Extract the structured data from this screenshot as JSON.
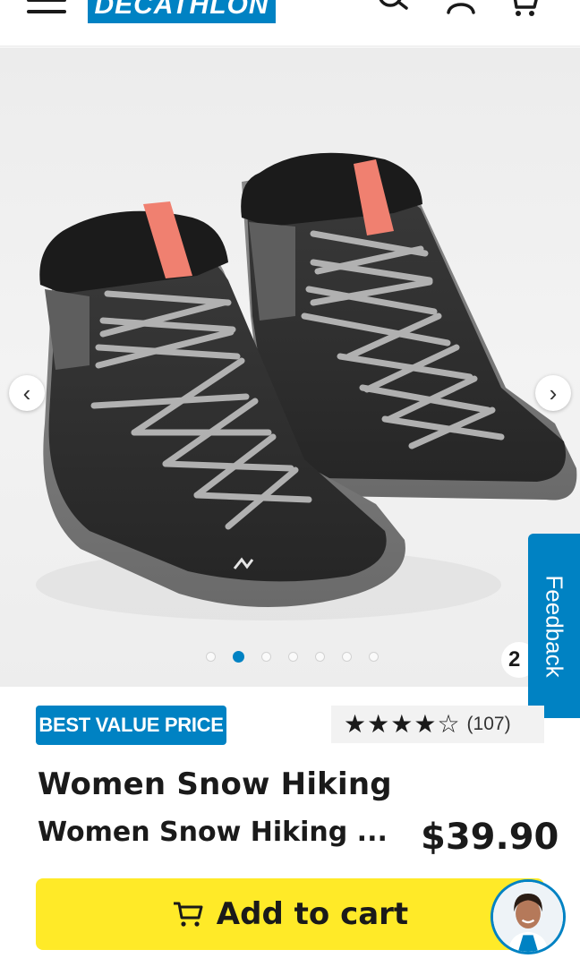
{
  "header": {
    "brand": "DECATHLON",
    "icons": [
      "menu-icon",
      "search-icon",
      "account-icon",
      "cart-icon"
    ]
  },
  "gallery": {
    "total_dots": 7,
    "active_dot_index": 1,
    "photo_count": "2",
    "prev_glyph": "‹",
    "next_glyph": "›"
  },
  "feedback": {
    "label": "Feedback"
  },
  "product": {
    "badge": "BEST VALUE PRICE",
    "rating_stars": 4,
    "rating_max": 5,
    "review_count": "(107)",
    "title": "Women Snow Hiking",
    "subtitle": "Women Snow Hiking ...",
    "price": "$39.90"
  },
  "cart": {
    "label": "Add to cart"
  },
  "colors": {
    "brand_blue": "#0082c3",
    "cart_yellow": "#ffea28"
  }
}
